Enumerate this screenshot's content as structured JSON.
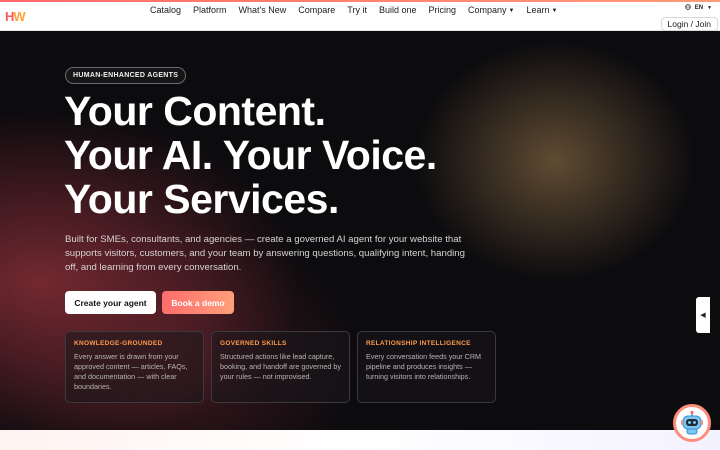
{
  "brand": {
    "logo_h": "H",
    "logo_w": "W"
  },
  "nav": {
    "items": [
      "Catalog",
      "Platform",
      "What's New",
      "Compare",
      "Try it",
      "Build one",
      "Pricing",
      "Company",
      "Learn"
    ],
    "language": "EN",
    "login_label": "Login / Join"
  },
  "hero": {
    "badge": "HUMAN-ENHANCED AGENTS",
    "headline_lines": [
      "Your Content.",
      "Your AI. Your Voice.",
      "Your Services."
    ],
    "subtext": "Built for SMEs, consultants, and agencies — create a governed AI agent for your website that supports visitors, customers, and your team by answering questions, qualifying intent, handing off, and learning from every conversation.",
    "cta_primary": "Create your agent",
    "cta_secondary": "Book a demo"
  },
  "features": [
    {
      "title": "KNOWLEDGE-GROUNDED",
      "body": "Every answer is drawn from your approved content — articles, FAQs, and documentation — with clear boundaries."
    },
    {
      "title": "GOVERNED SKILLS",
      "body": "Structured actions like lead capture, booking, and handoff are governed by your rules — not improvised."
    },
    {
      "title": "RELATIONSHIP INTELLIGENCE",
      "body": "Every conversation feeds your CRM pipeline and produces insights — turning visitors into relationships."
    }
  ],
  "side_tab_glyph": "◀",
  "icons": {
    "globe": "globe-icon",
    "chevron": "chevron-down-icon",
    "chat_bot": "robot-icon",
    "side_tab": "arrow-left-icon"
  },
  "colors": {
    "accent": "#ff6d6d",
    "accent_orange": "#ff9a4a",
    "hero_bg": "#0c0b0e"
  }
}
